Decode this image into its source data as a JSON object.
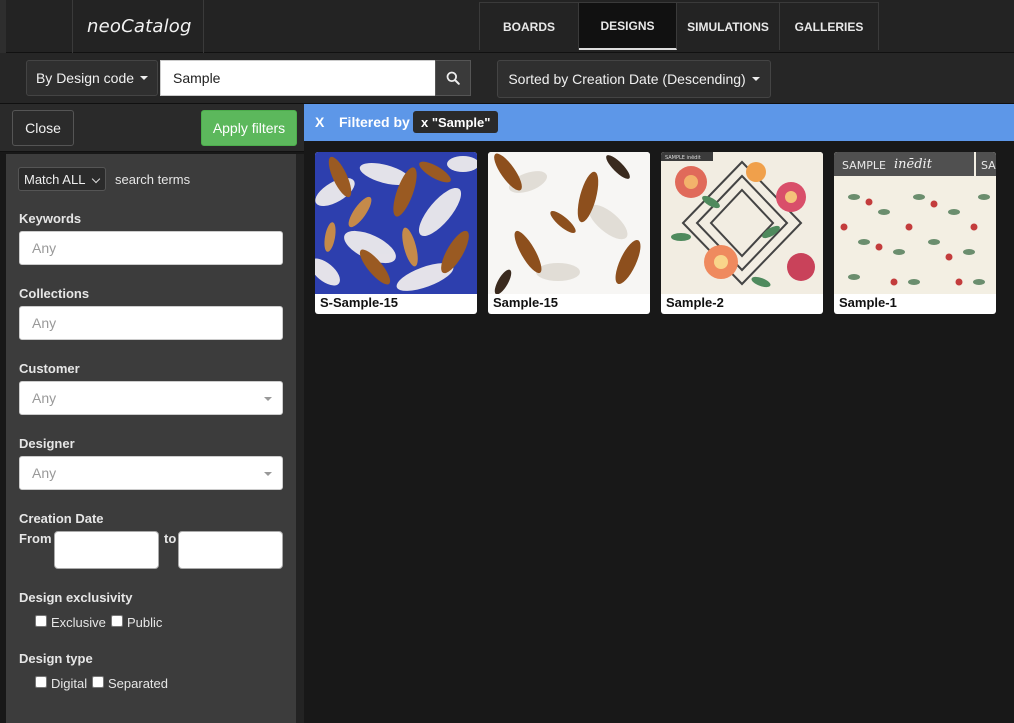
{
  "app": {
    "logo": "neoCatalog"
  },
  "nav": {
    "tabs": [
      {
        "label": "BOARDS"
      },
      {
        "label": "DESIGNS",
        "active": true
      },
      {
        "label": "SIMULATIONS"
      },
      {
        "label": "GALLERIES"
      }
    ]
  },
  "search": {
    "mode_label": "By Design code",
    "query": "Sample",
    "sort_label": "Sorted by Creation Date (Descending)"
  },
  "panel": {
    "close_label": "Close",
    "apply_label": "Apply filters",
    "match_value": "Match ALL",
    "match_suffix": "search terms",
    "keywords": {
      "label": "Keywords",
      "placeholder": "Any"
    },
    "collections": {
      "label": "Collections",
      "placeholder": "Any"
    },
    "customer": {
      "label": "Customer",
      "value": "Any"
    },
    "designer": {
      "label": "Designer",
      "value": "Any"
    },
    "creation_date": {
      "label": "Creation Date",
      "from_label": "From",
      "to_label": "to"
    },
    "exclusivity": {
      "label": "Design exclusivity",
      "options": [
        "Exclusive",
        "Public"
      ]
    },
    "type": {
      "label": "Design type",
      "options": [
        "Digital",
        "Separated"
      ]
    }
  },
  "filter_bar": {
    "clear_label": "X",
    "prefix": "Filtered by",
    "chip": "x \"Sample\""
  },
  "designs": [
    {
      "title": "S-Sample-15",
      "pattern": "feathers-blue"
    },
    {
      "title": "Sample-15",
      "pattern": "feathers-white"
    },
    {
      "title": "Sample-2",
      "pattern": "floral-geometric",
      "watermark": "SAMPLE inēdit"
    },
    {
      "title": "Sample-1",
      "pattern": "floral-small",
      "watermark": "SAMPLE inēdit"
    }
  ],
  "colors": {
    "accent_blue": "#5d97e8",
    "apply_green": "#5cb85c"
  }
}
